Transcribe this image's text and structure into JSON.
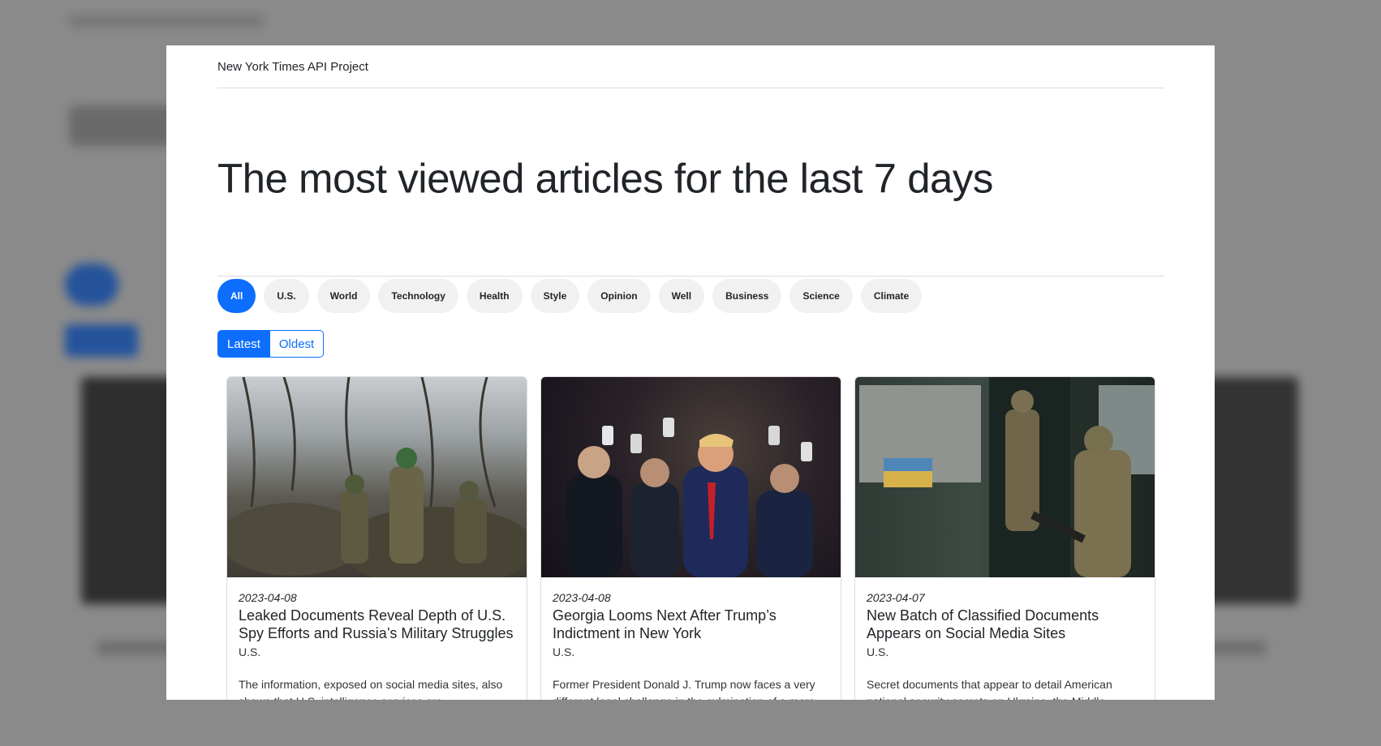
{
  "app": {
    "brand": "New York Times API Project",
    "heading": "The most viewed articles for the last 7 days"
  },
  "filters": [
    {
      "label": "All",
      "active": true
    },
    {
      "label": "U.S."
    },
    {
      "label": "World"
    },
    {
      "label": "Technology"
    },
    {
      "label": "Health"
    },
    {
      "label": "Style"
    },
    {
      "label": "Opinion"
    },
    {
      "label": "Well"
    },
    {
      "label": "Business"
    },
    {
      "label": "Science"
    },
    {
      "label": "Climate"
    }
  ],
  "sort": {
    "latest": "Latest",
    "oldest": "Oldest"
  },
  "articles": [
    {
      "date": "2023-04-08",
      "title": "Leaked Documents Reveal Depth of U.S. Spy Efforts and Russia’s Military Struggles",
      "section": "U.S.",
      "abstract": "The information, exposed on social media sites, also shows that U.S. intelligence services are",
      "image": "soldiers-in-trench-photo"
    },
    {
      "date": "2023-04-08",
      "title": "Georgia Looms Next After Trump’s Indictment in New York",
      "section": "U.S.",
      "abstract": "Former President Donald J. Trump now faces a very different legal challenge in the culmination of a more",
      "image": "crowd-with-phones-photo"
    },
    {
      "date": "2023-04-07",
      "title": "New Batch of Classified Documents Appears on Social Media Sites",
      "section": "U.S.",
      "abstract": "Secret documents that appear to detail American national security secrets on Ukraine, the Middle",
      "image": "soldiers-bus-photo"
    }
  ],
  "colors": {
    "primary": "#0d6efd",
    "pill_bg": "#f1f1f1",
    "overlay": "#8c8c8c"
  }
}
